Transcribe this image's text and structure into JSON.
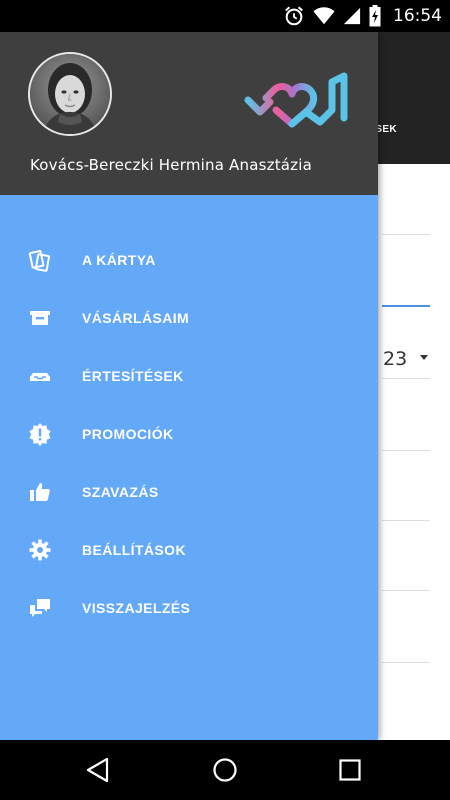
{
  "status_bar": {
    "time": "16:54",
    "icons": [
      "alarm-icon",
      "wifi-icon",
      "signal-icon",
      "battery-charging-icon"
    ]
  },
  "background_page": {
    "tab_label_partial": "TÉSEK",
    "select_value_partial": "23"
  },
  "drawer": {
    "user_name": "Kovács-Bereczki Hermina Anasztázia",
    "items": [
      {
        "label": "A KÁRTYA",
        "icon": "cards-icon"
      },
      {
        "label": "VÁSÁRLÁSAIM",
        "icon": "shopping-basket-icon"
      },
      {
        "label": "ÉRTESÍTÉSEK",
        "icon": "inbox-tray-icon"
      },
      {
        "label": "PROMOCIÓK",
        "icon": "promo-badge-icon"
      },
      {
        "label": "SZAVAZÁS",
        "icon": "thumbs-up-icon"
      },
      {
        "label": "BEÁLLÍTÁSOK",
        "icon": "settings-gear-icon"
      },
      {
        "label": "VISSZAJELZÉS",
        "icon": "feedback-chat-icon"
      }
    ]
  },
  "nav_bar": {
    "buttons": [
      "back-icon",
      "home-icon",
      "recents-icon"
    ]
  },
  "colors": {
    "drawer_bg": "#64a8f8",
    "drawer_header_bg": "#3f3f3f",
    "logo_pink": "#ee5d9a",
    "logo_blue": "#5bc3e8"
  }
}
